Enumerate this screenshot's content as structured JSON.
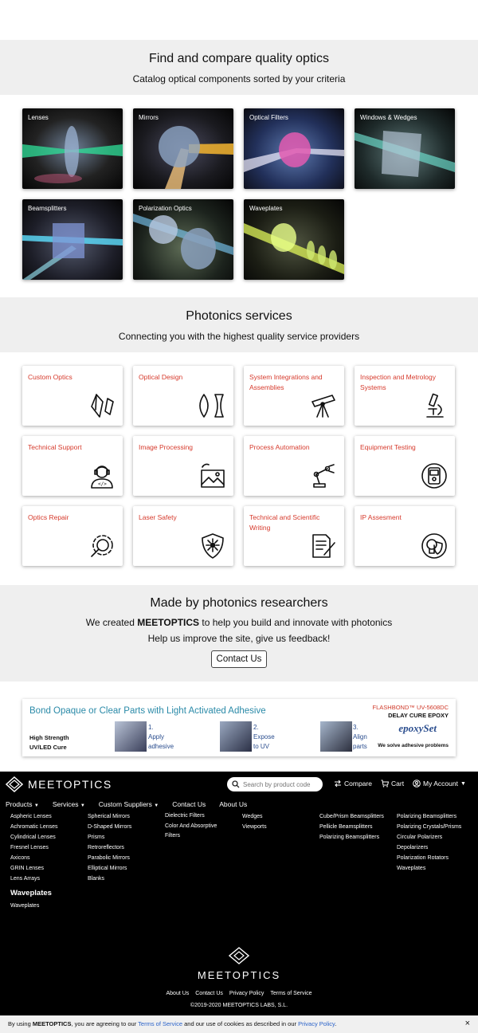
{
  "catalog": {
    "title": "Find and compare quality optics",
    "subtitle": "Catalog optical components sorted by your criteria",
    "items": [
      {
        "label": "Lenses"
      },
      {
        "label": "Mirrors"
      },
      {
        "label": "Optical Filters"
      },
      {
        "label": "Windows & Wedges"
      },
      {
        "label": "Beamsplitters"
      },
      {
        "label": "Polarization Optics"
      },
      {
        "label": "Waveplates"
      }
    ]
  },
  "services": {
    "title": "Photonics services",
    "subtitle": "Connecting you with the highest quality service providers",
    "items": [
      {
        "label": "Custom Optics",
        "icon": "crystal-icon"
      },
      {
        "label": "Optical Design",
        "icon": "lens-shapes-icon"
      },
      {
        "label": "System Integrations and Assemblies",
        "icon": "telescope-icon"
      },
      {
        "label": "Inspection and Metrology Systems",
        "icon": "microscope-icon"
      },
      {
        "label": "Technical Support",
        "icon": "support-person-icon"
      },
      {
        "label": "Image Processing",
        "icon": "image-icon"
      },
      {
        "label": "Process Automation",
        "icon": "robot-arm-icon"
      },
      {
        "label": "Equipment Testing",
        "icon": "meter-icon"
      },
      {
        "label": "Optics Repair",
        "icon": "gear-wrench-icon"
      },
      {
        "label": "Laser Safety",
        "icon": "laser-shield-icon"
      },
      {
        "label": "Technical and Scientific Writing",
        "icon": "document-pen-icon"
      },
      {
        "label": "IP Assesment",
        "icon": "ip-shield-icon"
      }
    ]
  },
  "about": {
    "title": "Made by photonics researchers",
    "line1_pre": "We created ",
    "line1_brand": "MEETOPTICS",
    "line1_post": " to help you build and innovate with photonics",
    "line2": "Help us improve the site, give us feedback!",
    "button": "Contact Us"
  },
  "ad": {
    "headline": "Bond Opaque or Clear Parts with Light Activated Adhesive",
    "product": "FLASHBOND™ UV-5608DC",
    "product_sub": "DELAY CURE EPOXY",
    "strength1": "High Strength",
    "strength2": "UV/LED Cure",
    "step1": [
      "1.",
      "Apply",
      "adhesive"
    ],
    "step2": [
      "2.",
      "Expose",
      "to UV"
    ],
    "step3": [
      "3.",
      "Align",
      "parts"
    ],
    "brand": "epoxySet",
    "tagline": "We solve adhesive problems"
  },
  "footer": {
    "logo": "MEETOPTICS",
    "search_placeholder": "Search by product code",
    "compare": "Compare",
    "cart": "Cart",
    "account": "My Account",
    "nav": [
      "Products",
      "Services",
      "Custom Suppliers",
      "Contact Us",
      "About Us"
    ],
    "col1": [
      "Aspheric Lenses",
      "Achromatic Lenses",
      "Cylindrical Lenses",
      "Fresnel Lenses",
      "Axicons",
      "GRIN Lenses",
      "Lens Arrays"
    ],
    "col2": [
      "Spherical Mirrors",
      "D-Shaped Mirrors",
      "Prisms",
      "Retroreflectors",
      "Parabolic Mirrors",
      "Elliptical Mirrors",
      "Blanks"
    ],
    "col3": [
      "Dielectric Filters",
      "Color And Absorptive",
      "Filters"
    ],
    "col4": [
      "Wedges",
      "Viewports"
    ],
    "col5": [
      "Cube/Prism Beamsplitters",
      "Pellicle Beamsplitters",
      "Polarizing Beamsplitters"
    ],
    "col6": [
      "Polarizing Beamsplitters",
      "Polarizing Crystals/Prisms",
      "Circular Polarizers",
      "Depolarizers",
      "Polarization Rotators",
      "Waveplates"
    ],
    "waveplates_heading": "Waveplates",
    "waveplates_item": "Waveplates",
    "bottom_logo": "MEETOPTICS",
    "links": [
      "About Us",
      "Contact Us",
      "Privacy Policy",
      "Terms of Service"
    ],
    "copyright": "©2019-2020 MEETOPTICS LABS, S.L."
  },
  "cookie": {
    "pre": "By using ",
    "brand": "MEETOPTICS",
    "mid": ", you are agreeing to our ",
    "tos": "Terms of Service",
    "mid2": " and our use of cookies as described in our ",
    "privacy": "Privacy Policy",
    "end": ".",
    "close": "×"
  }
}
